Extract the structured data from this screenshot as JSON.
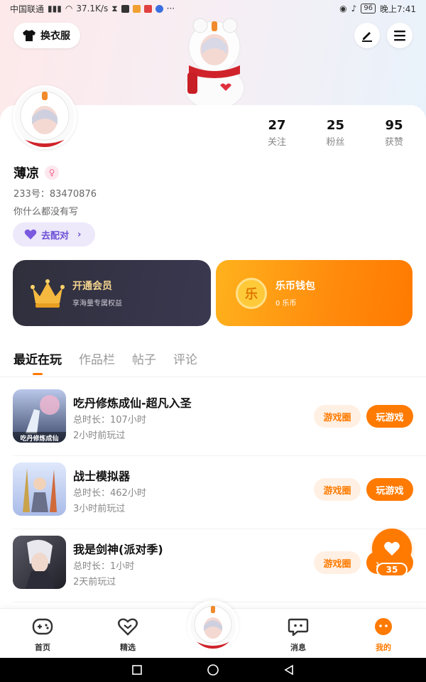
{
  "status_bar": {
    "carrier": "中国联通",
    "net_speed": "37.1K/s",
    "battery": "96",
    "time": "晚上7:41"
  },
  "header": {
    "outfit_label": "换衣服"
  },
  "profile": {
    "name": "薄凉",
    "uid": "233号：83470876",
    "bio": "你什么都没有写",
    "match_label": "去配对",
    "stats": [
      {
        "num": "27",
        "label": "关注"
      },
      {
        "num": "25",
        "label": "粉丝"
      },
      {
        "num": "95",
        "label": "获赞"
      }
    ]
  },
  "promos": {
    "vip": {
      "title": "开通会员",
      "sub": "享海量专属权益"
    },
    "wallet": {
      "title": "乐币钱包",
      "sub": "0 乐币",
      "coin": "乐"
    }
  },
  "tabs": [
    "最近在玩",
    "作品栏",
    "帖子",
    "评论"
  ],
  "games": [
    {
      "title": "吃丹修炼成仙-超凡入圣",
      "playtime": "总时长：107小时",
      "last": "2小时前玩过",
      "thumb_text": "吃丹修炼成仙",
      "circle_label": "游戏圈",
      "play_label": "玩游戏"
    },
    {
      "title": "战士模拟器",
      "playtime": "总时长：462小时",
      "last": "3小时前玩过",
      "circle_label": "游戏圈",
      "play_label": "玩游戏"
    },
    {
      "title": "我是剑神(派对季)",
      "playtime": "总时长：1小时",
      "last": "2天前玩过",
      "circle_label": "游戏圈",
      "play_label": "玩游戏"
    }
  ],
  "like_fab": {
    "count": "35"
  },
  "bottom_nav": [
    {
      "label": "首页"
    },
    {
      "label": "精选"
    },
    {
      "label": "消息"
    },
    {
      "label": "我的"
    }
  ],
  "colors": {
    "accent": "#ff7a00",
    "vip_gold": "#f5d58f",
    "match_purple": "#6b4fd6"
  }
}
